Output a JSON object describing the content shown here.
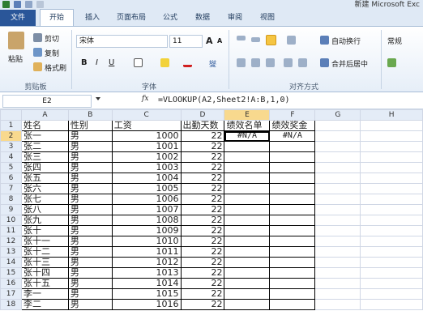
{
  "window": {
    "title": "新建 Microsoft Exc"
  },
  "tabs": [
    "文件",
    "开始",
    "插入",
    "页面布局",
    "公式",
    "数据",
    "审阅",
    "视图"
  ],
  "clipboard": {
    "paste": "粘贴",
    "cut": "剪切",
    "copy": "复制",
    "format_painter": "格式刷",
    "group": "剪贴板"
  },
  "font": {
    "name": "宋体",
    "size": "11",
    "bold": "B",
    "italic": "I",
    "underline": "U",
    "grow": "A",
    "shrink": "A",
    "phonetic": "燮",
    "group": "字体"
  },
  "alignment": {
    "wrap": "自动换行",
    "merge": "合并后居中",
    "group": "对齐方式"
  },
  "number": {
    "format": "常规"
  },
  "formula_bar": {
    "name_box": "E2",
    "fx": "fx",
    "formula": "=VLOOKUP(A2,Sheet2!A:B,1,0)"
  },
  "grid": {
    "columns": [
      "A",
      "B",
      "C",
      "D",
      "E",
      "F",
      "G",
      "H"
    ],
    "headers": [
      "姓名",
      "性别",
      "工资",
      "出勤天数",
      "绩效名单",
      "绩效奖金"
    ],
    "rows": [
      {
        "n": "2",
        "name": "张一",
        "gender": "男",
        "salary": "1000",
        "days": "22",
        "e": "#N/A",
        "f": "#N/A"
      },
      {
        "n": "3",
        "name": "张二",
        "gender": "男",
        "salary": "1001",
        "days": "22",
        "e": "",
        "f": ""
      },
      {
        "n": "4",
        "name": "张三",
        "gender": "男",
        "salary": "1002",
        "days": "22",
        "e": "",
        "f": ""
      },
      {
        "n": "5",
        "name": "张四",
        "gender": "男",
        "salary": "1003",
        "days": "22",
        "e": "",
        "f": ""
      },
      {
        "n": "6",
        "name": "张五",
        "gender": "男",
        "salary": "1004",
        "days": "22",
        "e": "",
        "f": ""
      },
      {
        "n": "7",
        "name": "张六",
        "gender": "男",
        "salary": "1005",
        "days": "22",
        "e": "",
        "f": ""
      },
      {
        "n": "8",
        "name": "张七",
        "gender": "男",
        "salary": "1006",
        "days": "22",
        "e": "",
        "f": ""
      },
      {
        "n": "9",
        "name": "张八",
        "gender": "男",
        "salary": "1007",
        "days": "22",
        "e": "",
        "f": ""
      },
      {
        "n": "10",
        "name": "张九",
        "gender": "男",
        "salary": "1008",
        "days": "22",
        "e": "",
        "f": ""
      },
      {
        "n": "11",
        "name": "张十",
        "gender": "男",
        "salary": "1009",
        "days": "22",
        "e": "",
        "f": ""
      },
      {
        "n": "12",
        "name": "张十一",
        "gender": "男",
        "salary": "1010",
        "days": "22",
        "e": "",
        "f": ""
      },
      {
        "n": "13",
        "name": "张十二",
        "gender": "男",
        "salary": "1011",
        "days": "22",
        "e": "",
        "f": ""
      },
      {
        "n": "14",
        "name": "张十三",
        "gender": "男",
        "salary": "1012",
        "days": "22",
        "e": "",
        "f": ""
      },
      {
        "n": "15",
        "name": "张十四",
        "gender": "男",
        "salary": "1013",
        "days": "22",
        "e": "",
        "f": ""
      },
      {
        "n": "16",
        "name": "张十五",
        "gender": "男",
        "salary": "1014",
        "days": "22",
        "e": "",
        "f": ""
      },
      {
        "n": "17",
        "name": "李一",
        "gender": "男",
        "salary": "1015",
        "days": "22",
        "e": "",
        "f": ""
      },
      {
        "n": "18",
        "name": "李二",
        "gender": "男",
        "salary": "1016",
        "days": "22",
        "e": "",
        "f": ""
      }
    ]
  }
}
